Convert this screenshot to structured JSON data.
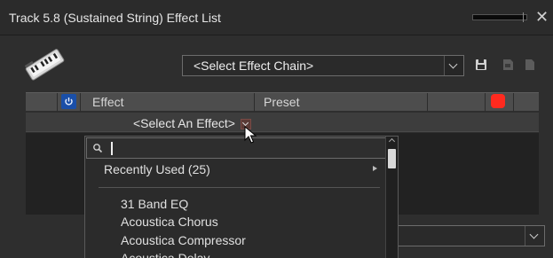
{
  "window": {
    "title": "Track 5.8 (Sustained String) Effect List",
    "close_glyph": "✕"
  },
  "toolbar": {
    "effect_chain_select": "<Select Effect Chain>",
    "icons": [
      "keyboard-icon",
      "save-icon",
      "copy-icon",
      "document-icon"
    ]
  },
  "table": {
    "columns": {
      "effect": "Effect",
      "preset": "Preset"
    },
    "row": {
      "select_effect": "<Select An Effect>"
    },
    "colors": {
      "power": "#1a4fa8",
      "record": "#ff2a1f"
    }
  },
  "dropdown": {
    "search_value": "",
    "recently_used": "Recently Used (25)",
    "items": [
      "31 Band EQ",
      "Acoustica Chorus",
      "Acoustica Compressor",
      "Acoustica Delay"
    ]
  }
}
